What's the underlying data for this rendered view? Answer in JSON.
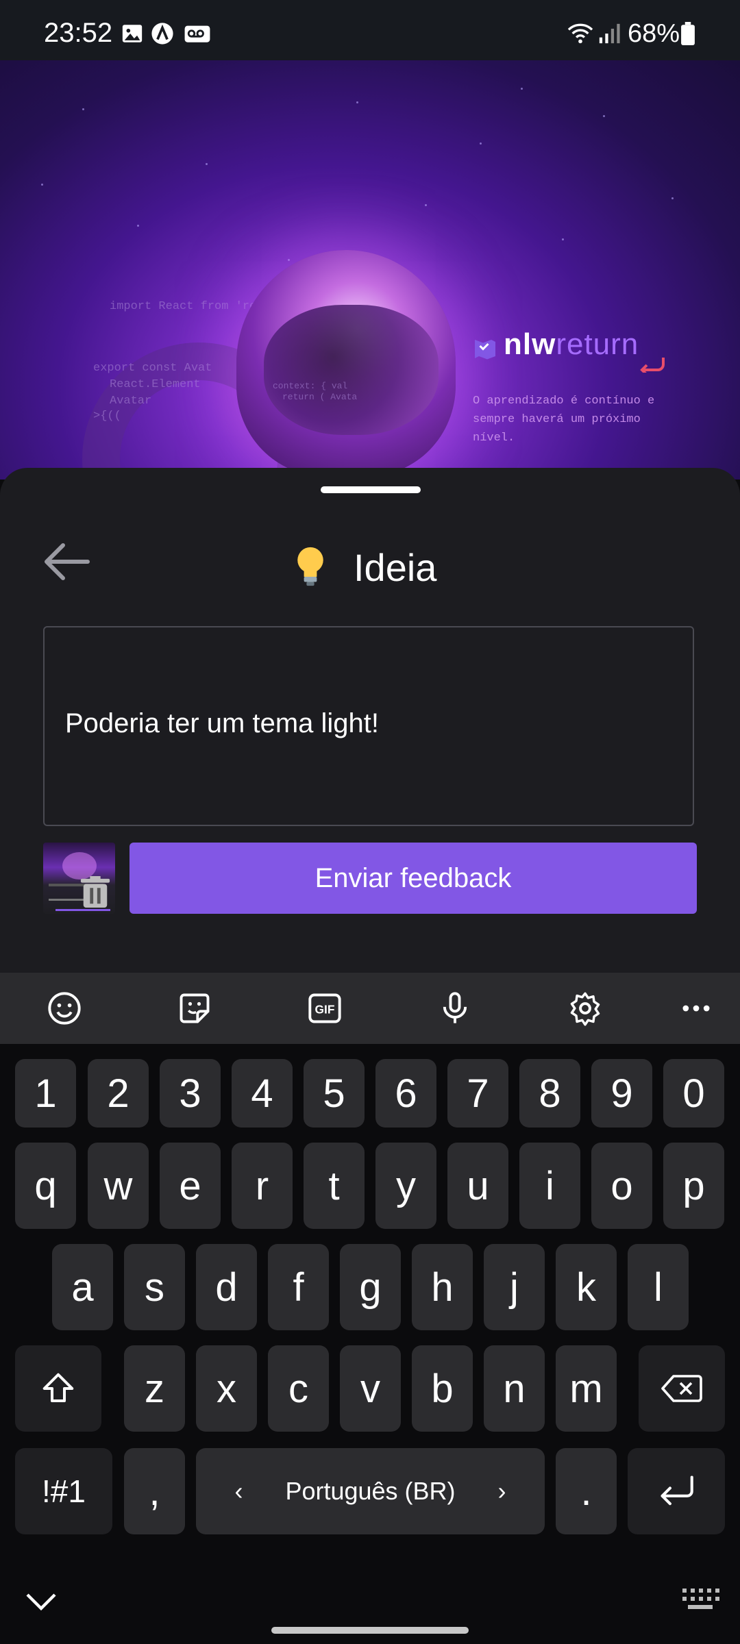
{
  "status_bar": {
    "time": "23:52",
    "battery_percent": "68%",
    "icons": [
      "image-icon",
      "a-circle-icon",
      "voicemail-icon",
      "wifi-icon",
      "signal-icon",
      "battery-icon"
    ]
  },
  "hero": {
    "brand_prefix": "nlw",
    "brand_suffix": "return",
    "tagline": "O aprendizado é contínuo e sempre haverá um próximo nível.",
    "code_lines": [
      "import React from 'react'",
      "export const Avat",
      "React.Element",
      "Avatar",
      ">{((",
      "context: { val",
      "return ( Avata"
    ]
  },
  "sheet": {
    "title": "Ideia",
    "title_icon": "lightbulb-icon",
    "feedback_text": "Poderia ter um tema light!",
    "send_label": "Enviar feedback",
    "accent_color": "#8257e5"
  },
  "keyboard": {
    "toolbar_icons": [
      "emoji-icon",
      "sticker-icon",
      "gif-icon",
      "mic-icon",
      "settings-icon",
      "more-icon"
    ],
    "row_numbers": [
      "1",
      "2",
      "3",
      "4",
      "5",
      "6",
      "7",
      "8",
      "9",
      "0"
    ],
    "row_1": [
      "q",
      "w",
      "e",
      "r",
      "t",
      "y",
      "u",
      "i",
      "o",
      "p"
    ],
    "row_2": [
      "a",
      "s",
      "d",
      "f",
      "g",
      "h",
      "j",
      "k",
      "l"
    ],
    "row_3": [
      "z",
      "x",
      "c",
      "v",
      "b",
      "n",
      "m"
    ],
    "symbols_label": "!#1",
    "comma": ",",
    "language": "Português (BR)",
    "period": "."
  }
}
